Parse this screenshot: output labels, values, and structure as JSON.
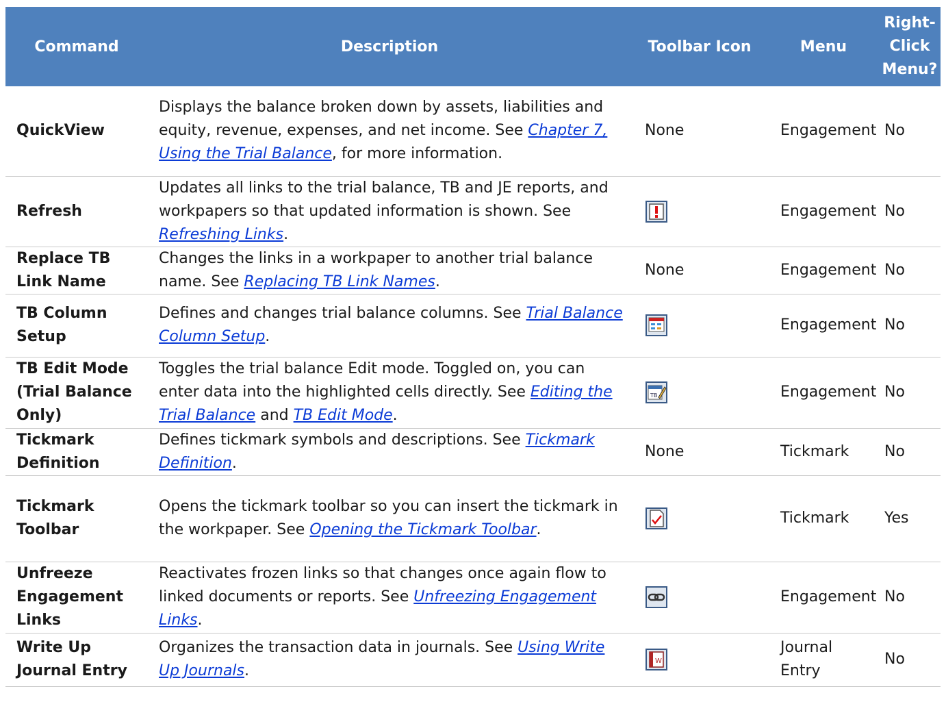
{
  "headers": {
    "command": "Command",
    "description": "Description",
    "toolbar_icon": "Toolbar Icon",
    "menu": "Menu",
    "right_click": "Right-Click Menu?"
  },
  "rows": [
    {
      "command": "QuickView",
      "desc_pre": "Displays the balance broken down by assets, liabilities and equity, revenue, expenses, and net income. See ",
      "link1": "Chapter 7, Using the Trial Balance",
      "desc_mid": ", for more information.",
      "link2": "",
      "desc_post": "",
      "icon_text": "None",
      "icon_name": "",
      "menu": "Engagement",
      "right_click": "No"
    },
    {
      "command": "Refresh",
      "desc_pre": "Updates all links to the trial balance, TB and JE reports, and workpapers so that updated information is shown. See ",
      "link1": "Refreshing Links",
      "desc_mid": ".",
      "link2": "",
      "desc_post": "",
      "icon_text": "",
      "icon_name": "refresh-icon",
      "menu": "Engagement",
      "right_click": "No"
    },
    {
      "command": "Replace TB Link Name",
      "desc_pre": "Changes the links in a workpaper to another trial balance name. See ",
      "link1": "Replacing TB Link Names",
      "desc_mid": ".",
      "link2": "",
      "desc_post": "",
      "icon_text": "None",
      "icon_name": "",
      "menu": "Engagement",
      "right_click": "No"
    },
    {
      "command": "TB Column Setup",
      "desc_pre": "Defines and changes trial balance columns. See ",
      "link1": "Trial Balance Column Setup",
      "desc_mid": ".",
      "link2": "",
      "desc_post": "",
      "icon_text": "",
      "icon_name": "tb-column-setup-icon",
      "menu": "Engagement",
      "right_click": "No"
    },
    {
      "command": "TB Edit Mode (Trial Balance Only)",
      "desc_pre": "Toggles the trial balance Edit mode. Toggled on, you can enter data into the highlighted cells directly. See ",
      "link1": "Editing the Trial Balance",
      "desc_mid": " and ",
      "link2": "TB Edit Mode",
      "desc_post": ".",
      "icon_text": "",
      "icon_name": "tb-edit-mode-icon",
      "menu": "Engagement",
      "right_click": "No"
    },
    {
      "command": "Tickmark Definition",
      "desc_pre": "Defines tickmark symbols and descriptions. See ",
      "link1": "Tickmark Definition",
      "desc_mid": ".",
      "link2": "",
      "desc_post": "",
      "icon_text": "None",
      "icon_name": "",
      "menu": "Tickmark",
      "right_click": "No"
    },
    {
      "command": "Tickmark Toolbar",
      "desc_pre": "Opens the tickmark toolbar so you can insert the tickmark in the workpaper. See ",
      "link1": "Opening the Tickmark Toolbar",
      "desc_mid": ".",
      "link2": "",
      "desc_post": "",
      "icon_text": "",
      "icon_name": "tickmark-toolbar-icon",
      "menu": "Tickmark",
      "right_click": "Yes"
    },
    {
      "command": "Unfreeze Engagement Links",
      "desc_pre": "Reactivates frozen links so that changes once again flow to linked documents or reports. See ",
      "link1": "Unfreezing Engagement Links",
      "desc_mid": ".",
      "link2": "",
      "desc_post": "",
      "icon_text": "",
      "icon_name": "unfreeze-links-icon",
      "menu": "Engagement",
      "right_click": "No"
    },
    {
      "command": "Write Up Journal Entry",
      "desc_pre": "Organizes the transaction data in journals. See ",
      "link1": "Using Write Up Journals",
      "desc_mid": ".",
      "link2": "",
      "desc_post": "",
      "icon_text": "",
      "icon_name": "journal-entry-icon",
      "menu": "Journal Entry",
      "right_click": "No"
    }
  ]
}
